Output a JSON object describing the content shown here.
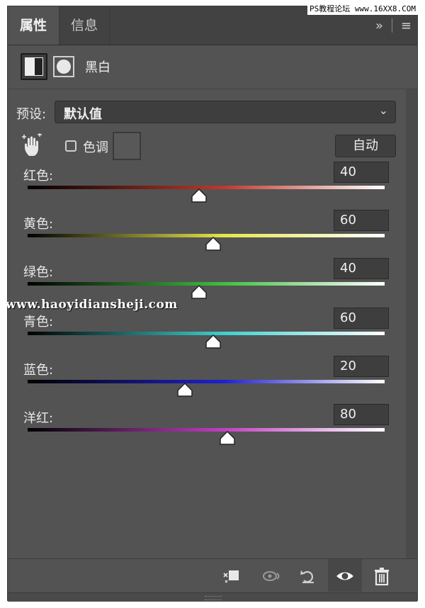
{
  "tabs": {
    "active": "属性",
    "inactive": "信息"
  },
  "header": {
    "title": "黑白"
  },
  "preset": {
    "label": "预设:",
    "value": "默认值"
  },
  "tint": {
    "label": "色调",
    "checked": false
  },
  "auto_button": "自动",
  "sliders": [
    {
      "label": "红色:",
      "value": "40",
      "position": 0.48,
      "colors": [
        "#000000",
        "#c0392b",
        "#ffffff"
      ]
    },
    {
      "label": "黄色:",
      "value": "60",
      "position": 0.52,
      "colors": [
        "#000000",
        "#e6e64a",
        "#ffffff"
      ]
    },
    {
      "label": "绿色:",
      "value": "40",
      "position": 0.48,
      "colors": [
        "#000000",
        "#3fbf3f",
        "#ffffff"
      ]
    },
    {
      "label": "青色:",
      "value": "60",
      "position": 0.52,
      "colors": [
        "#000000",
        "#3fcfcf",
        "#ffffff"
      ]
    },
    {
      "label": "蓝色:",
      "value": "20",
      "position": 0.44,
      "colors": [
        "#000000",
        "#2020d0",
        "#ffffff"
      ]
    },
    {
      "label": "洋红:",
      "value": "80",
      "position": 0.56,
      "colors": [
        "#000000",
        "#c03fc0",
        "#ffffff"
      ]
    }
  ],
  "watermark": "www.haoyidiansheji.com",
  "badge": "PS教程论坛 www.16XX8.COM",
  "icons": {
    "tools": [
      "expand-icon",
      "panel-menu-icon"
    ],
    "bottom": [
      "clip-to-layer-icon",
      "view-previous-state-icon",
      "reset-icon",
      "visibility-eye-icon",
      "trash-icon"
    ]
  }
}
